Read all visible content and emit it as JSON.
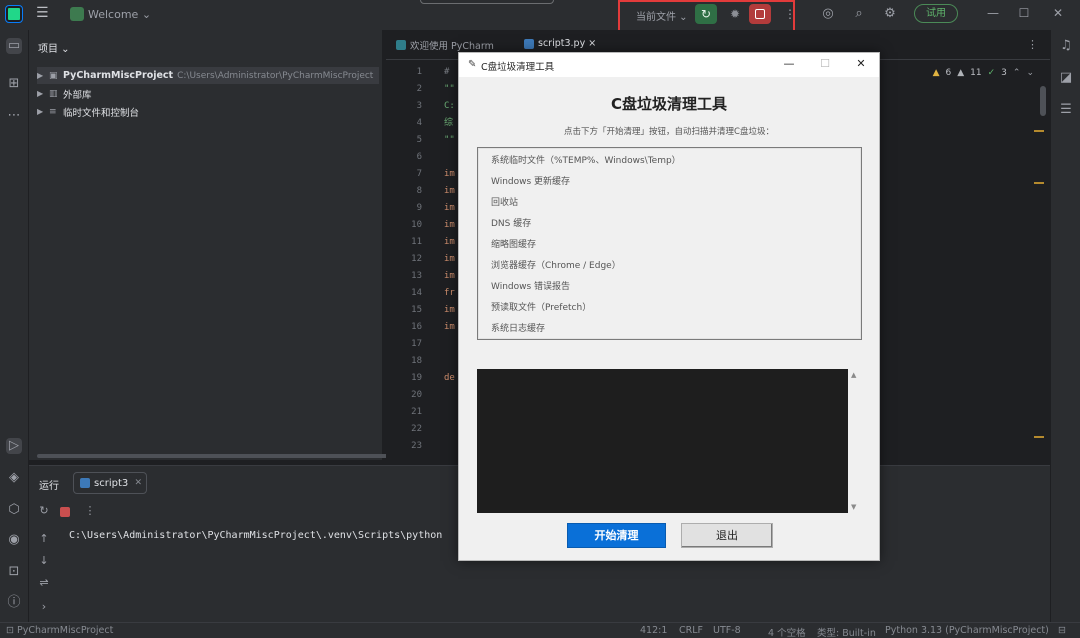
{
  "titlebar": {
    "project_label": "Welcome ⌄",
    "run_config": "当前文件 ⌄",
    "trial": "试用"
  },
  "project_panel": {
    "header": "项目 ⌄",
    "tree": [
      {
        "name": "PyCharmMiscProject",
        "path": "C:\\Users\\Administrator\\PyCharmMiscProject"
      },
      {
        "name": "外部库",
        "path": ""
      },
      {
        "name": "临时文件和控制台",
        "path": ""
      }
    ]
  },
  "editor": {
    "tabs": [
      "欢迎使用 PyCharm",
      "script3.py ×"
    ],
    "line_numbers": [
      "1",
      "2",
      "3",
      "4",
      "5",
      "6",
      "7",
      "8",
      "9",
      "10",
      "11",
      "12",
      "13",
      "14",
      "15",
      "16",
      "17",
      "18",
      "19",
      "20",
      "21",
      "22",
      "23"
    ],
    "code_lines": [
      "#",
      "\"\"",
      "C:",
      "综",
      "\"\"",
      "",
      "im",
      "im",
      "im",
      "im",
      "im",
      "im",
      "im",
      "fr",
      "im",
      "im",
      "",
      "",
      "de",
      "",
      "",
      "",
      ""
    ],
    "inspections": {
      "warnings": "6",
      "weak": "11",
      "ok": "3"
    }
  },
  "run_panel": {
    "label": "运行",
    "tab": "script3",
    "command": "C:\\Users\\Administrator\\PyCharmMiscProject\\.venv\\Scripts\\python"
  },
  "statusbar": {
    "project": "PyCharmMiscProject",
    "position": "412:1",
    "line_sep": "CRLF",
    "encoding": "UTF-8",
    "indent": "4 个空格",
    "type": "类型: Built-in",
    "interpreter": "Python 3.13 (PyCharmMiscProject)"
  },
  "dialog": {
    "window_title": "C盘垃圾清理工具",
    "heading": "C盘垃圾清理工具",
    "subtitle": "点击下方「开始清理」按钮，自动扫描并清理C盘垃圾：",
    "items": [
      "系统临时文件（%TEMP%、Windows\\Temp）",
      "Windows 更新缓存",
      "回收站",
      "DNS 缓存",
      "缩略图缓存",
      "浏览器缓存（Chrome / Edge）",
      "Windows 错误报告",
      "预读取文件（Prefetch）",
      "系统日志缓存"
    ],
    "start_button": "开始清理",
    "exit_button": "退出"
  },
  "colors": {
    "ide_bg": "#1e1f22",
    "panel_bg": "#2b2d30",
    "highlight_box": "#e23b3b",
    "start_button": "#0a70d8"
  }
}
